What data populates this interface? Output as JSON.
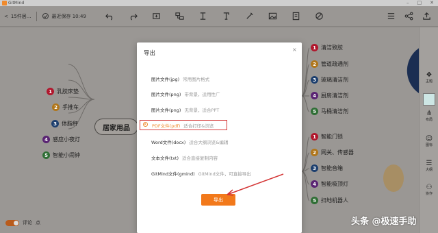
{
  "window": {
    "title": "GitMind"
  },
  "toolbar": {
    "back_label": "<",
    "doc_tab": "15件居...",
    "save_status": "最近保存 10:49"
  },
  "mindmap": {
    "center": "居家用品",
    "left_nodes": [
      {
        "num": "1",
        "label": "乳胶床垫"
      },
      {
        "num": "2",
        "label": "手推车"
      },
      {
        "num": "3",
        "label": "体脂秤"
      },
      {
        "num": "4",
        "label": "感应小夜灯"
      },
      {
        "num": "5",
        "label": "智能小闹钟"
      }
    ],
    "right_top_nodes": [
      {
        "num": "1",
        "label": "清洁致胶"
      },
      {
        "num": "2",
        "label": "管道疏通剂"
      },
      {
        "num": "3",
        "label": "玻璃清洁剂"
      },
      {
        "num": "4",
        "label": "厨房清洁剂"
      },
      {
        "num": "5",
        "label": "马桶清洁剂"
      }
    ],
    "right_bottom_nodes": [
      {
        "num": "1",
        "label": "智能门锁"
      },
      {
        "num": "2",
        "label": "网关、传感器"
      },
      {
        "num": "3",
        "label": "智能音箱"
      },
      {
        "num": "4",
        "label": "智能吸顶灯"
      },
      {
        "num": "5",
        "label": "扫地机器人"
      }
    ]
  },
  "sidebar": {
    "items": [
      {
        "icon": "theme",
        "label": "主题"
      },
      {
        "icon": "structure",
        "label": "布局"
      },
      {
        "icon": "icons",
        "label": "图标"
      },
      {
        "icon": "outline",
        "label": "大纲"
      },
      {
        "icon": "collab",
        "label": "协作"
      }
    ]
  },
  "bottom": {
    "label": "评论",
    "label2": "点"
  },
  "dialog": {
    "title": "导出",
    "close": "×",
    "options": [
      {
        "name": "图片文件(jpg)",
        "desc": "常用图片格式"
      },
      {
        "name": "图片文件(png)",
        "desc": "带背景，适用性广"
      },
      {
        "name": "图片文件(png)",
        "desc": "无背景，适合PPT"
      },
      {
        "name": "PDF文件(pdf)",
        "desc": "适合打印&浏览",
        "selected": true
      },
      {
        "name": "Word文件(docx)",
        "desc": "适合大纲浏览&编辑"
      },
      {
        "name": "文本文件(txt)",
        "desc": "适合直接复制内容"
      },
      {
        "name": "GitMind文件(gmind)",
        "desc": "GitMind文件，可直接导出"
      }
    ],
    "export_button": "导出"
  },
  "watermark": "头条 @极速手助",
  "colors": {
    "accent": "#f2791b",
    "selection_border": "#d43535"
  }
}
